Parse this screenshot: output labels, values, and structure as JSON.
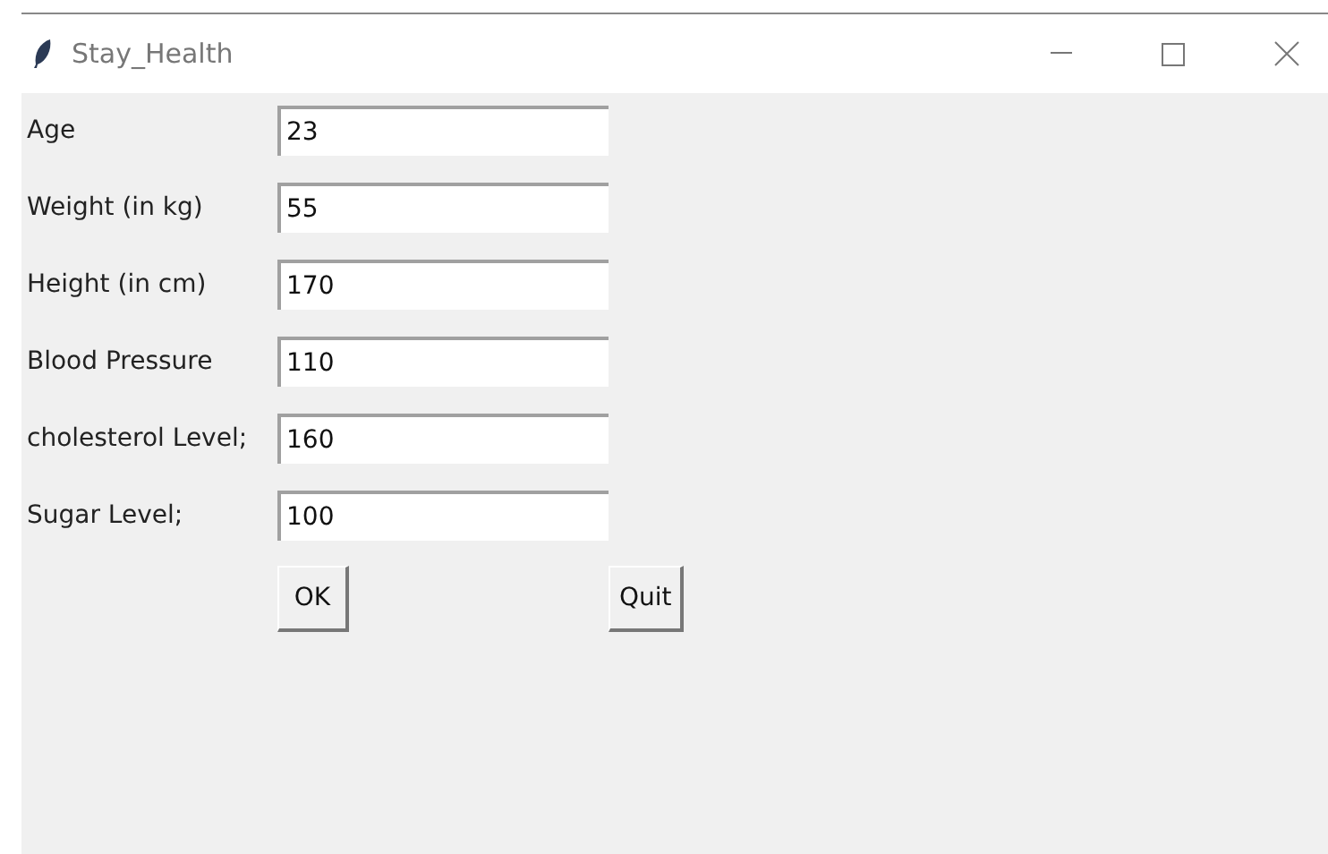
{
  "window": {
    "title": "Stay_Health"
  },
  "fields": [
    {
      "label": "Age",
      "value": "23"
    },
    {
      "label": "Weight (in kg)",
      "value": "55"
    },
    {
      "label": "Height (in cm)",
      "value": "170"
    },
    {
      "label": "Blood Pressure",
      "value": "110"
    },
    {
      "label": "cholesterol Level;",
      "value": "160"
    },
    {
      "label": "Sugar Level;",
      "value": "100"
    }
  ],
  "buttons": [
    {
      "label": "OK"
    },
    {
      "label": "Quit"
    }
  ]
}
